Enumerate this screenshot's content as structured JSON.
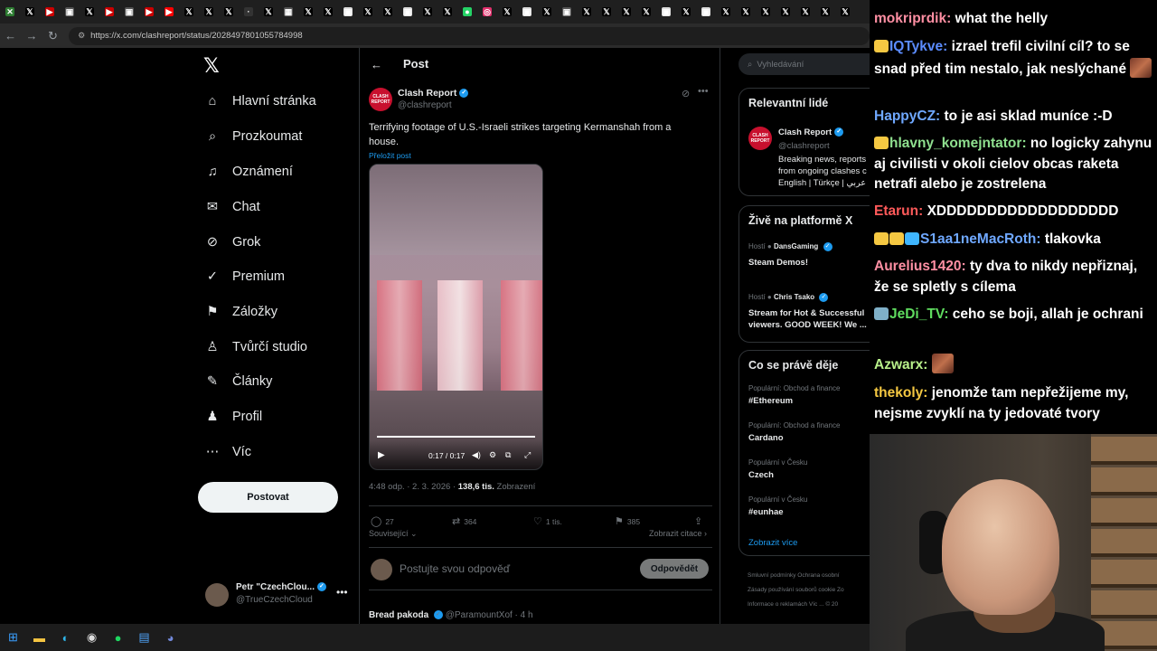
{
  "browser": {
    "url": "https://x.com/clashreport/status/2028497801055784998",
    "tabs": [
      {
        "icon": "green-x-icon",
        "color": "#2e7d32",
        "glyph": "✕"
      },
      {
        "icon": "x-icon",
        "color": "#000",
        "glyph": "𝕏"
      },
      {
        "icon": "youtube-icon",
        "color": "#c00",
        "glyph": "▶"
      },
      {
        "icon": "app-icon",
        "color": "#555",
        "glyph": "▣"
      },
      {
        "icon": "x-icon",
        "color": "#000",
        "glyph": "𝕏"
      },
      {
        "icon": "youtube-icon",
        "color": "#c00",
        "glyph": "▶"
      },
      {
        "icon": "app-icon",
        "color": "#555",
        "glyph": "▣"
      },
      {
        "icon": "youtube-icon",
        "color": "#c00",
        "glyph": "▶"
      },
      {
        "icon": "youtube-icon",
        "color": "#f00",
        "glyph": "▶"
      },
      {
        "icon": "x-icon",
        "color": "#000",
        "glyph": "𝕏"
      },
      {
        "icon": "x-icon",
        "color": "#000",
        "glyph": "𝕏"
      },
      {
        "icon": "x-icon",
        "color": "#000",
        "glyph": "𝕏"
      },
      {
        "icon": "blank-icon",
        "color": "#333",
        "glyph": "·"
      },
      {
        "icon": "x-icon",
        "color": "#000",
        "glyph": "𝕏"
      },
      {
        "icon": "app-icon",
        "color": "#555",
        "glyph": "▦"
      },
      {
        "icon": "x-icon",
        "color": "#000",
        "glyph": "𝕏"
      },
      {
        "icon": "x-icon",
        "color": "#000",
        "glyph": "𝕏"
      },
      {
        "icon": "app-icon",
        "color": "#ddd",
        "glyph": "▣"
      },
      {
        "icon": "x-icon",
        "color": "#000",
        "glyph": "𝕏"
      },
      {
        "icon": "x-icon",
        "color": "#000",
        "glyph": "𝕏"
      },
      {
        "icon": "app-icon",
        "color": "#ddd",
        "glyph": "▣"
      },
      {
        "icon": "x-icon",
        "color": "#000",
        "glyph": "𝕏"
      },
      {
        "icon": "x-icon",
        "color": "#000",
        "glyph": "𝕏"
      },
      {
        "icon": "whatsapp-icon",
        "color": "#25d366",
        "glyph": "●"
      },
      {
        "icon": "instagram-icon",
        "color": "#e1306c",
        "glyph": "◎"
      },
      {
        "icon": "x-icon",
        "color": "#000",
        "glyph": "𝕏"
      },
      {
        "icon": "app-icon",
        "color": "#ddd",
        "glyph": "▣"
      },
      {
        "icon": "x-icon",
        "color": "#000",
        "glyph": "𝕏"
      },
      {
        "icon": "app-icon",
        "color": "#555",
        "glyph": "▣"
      },
      {
        "icon": "x-icon",
        "color": "#000",
        "glyph": "𝕏"
      },
      {
        "icon": "x-icon",
        "color": "#000",
        "glyph": "𝕏"
      },
      {
        "icon": "x-icon",
        "color": "#000",
        "glyph": "𝕏"
      },
      {
        "icon": "x-icon",
        "color": "#000",
        "glyph": "𝕏"
      },
      {
        "icon": "app-icon",
        "color": "#ddd",
        "glyph": "▣"
      },
      {
        "icon": "x-icon",
        "color": "#000",
        "glyph": "𝕏"
      },
      {
        "icon": "app-icon",
        "color": "#ddd",
        "glyph": "▣"
      },
      {
        "icon": "x-icon",
        "color": "#000",
        "glyph": "𝕏"
      },
      {
        "icon": "x-icon",
        "color": "#000",
        "glyph": "𝕏"
      },
      {
        "icon": "x-icon",
        "color": "#000",
        "glyph": "𝕏"
      },
      {
        "icon": "x-icon",
        "color": "#000",
        "glyph": "𝕏"
      },
      {
        "icon": "x-icon",
        "color": "#000",
        "glyph": "𝕏"
      },
      {
        "icon": "x-icon",
        "color": "#000",
        "glyph": "𝕏"
      },
      {
        "icon": "x-icon",
        "color": "#000",
        "glyph": "𝕏"
      }
    ]
  },
  "nav": {
    "logo": "𝕏",
    "items": [
      {
        "label": "Hlavní stránka",
        "icon": "home-icon",
        "glyph": "⌂"
      },
      {
        "label": "Prozkoumat",
        "icon": "search-icon",
        "glyph": "⌕"
      },
      {
        "label": "Oznámení",
        "icon": "bell-icon",
        "glyph": "♫"
      },
      {
        "label": "Chat",
        "icon": "mail-icon",
        "glyph": "✉"
      },
      {
        "label": "Grok",
        "icon": "grok-icon",
        "glyph": "⊘"
      },
      {
        "label": "Premium",
        "icon": "verified-icon",
        "glyph": "✓"
      },
      {
        "label": "Záložky",
        "icon": "bookmark-icon",
        "glyph": "⚑"
      },
      {
        "label": "Tvůrčí studio",
        "icon": "studio-icon",
        "glyph": "♙"
      },
      {
        "label": "Články",
        "icon": "article-icon",
        "glyph": "✎"
      },
      {
        "label": "Profil",
        "icon": "profile-icon",
        "glyph": "♟"
      },
      {
        "label": "Víc",
        "icon": "more-icon",
        "glyph": "⋯"
      }
    ],
    "post_button": "Postovat",
    "profile_name": "Petr \"CzechClou...",
    "profile_handle": "@TrueCzechCloud"
  },
  "post": {
    "header_title": "Post",
    "author": "Clash Report",
    "handle": "@clashreport",
    "avatar_text": "CLASH REPORT",
    "text": "Terrifying footage of U.S.-Israeli strikes targeting Kermanshah from a house.",
    "translate": "Přeložit post",
    "video_time": "0:17 / 0:17",
    "video_progress": 1.0,
    "timestamp": "4:48 odp. · 2. 3. 2026 · ",
    "views_count": "138,6 tis.",
    "views_label": "Zobrazení",
    "replies": "27",
    "reposts": "364",
    "likes": "1 tis.",
    "bookmarks": "385",
    "related": "Související",
    "quotes": "Zobrazit citace",
    "reply_placeholder": "Postujte svou odpověď",
    "reply_button": "Odpovědět",
    "next_author": "Bread pakoda",
    "next_meta": "@ParamountXof · 4 h"
  },
  "sidebar": {
    "search_placeholder": "Vyhledávání",
    "relevant_title": "Relevantní lidé",
    "relevant_name": "Clash Report",
    "relevant_handle": "@clashreport",
    "relevant_bio_1": "Breaking news, reports",
    "relevant_bio_2": "from ongoing clashes c",
    "relevant_bio_3": "English | Türkçe | عربي",
    "live_title": "Živě na platformě X",
    "live_1_host": "Hostí",
    "live_1_name": "DansGaming",
    "live_1_title": "Steam Demos!",
    "live_2_host": "Hostí",
    "live_2_name": "Chris Tsako",
    "live_2_title_1": "Stream for Hot & Successful",
    "live_2_title_2": "viewers. GOOD WEEK! We ...",
    "trends_title": "Co se právě děje",
    "trends": [
      {
        "context": "Populární: Obchod a finance",
        "name": "#Ethereum"
      },
      {
        "context": "Populární: Obchod a finance",
        "name": "Cardano"
      },
      {
        "context": "Populární v Česku",
        "name": "Czech"
      },
      {
        "context": "Populární v Česku",
        "name": "#eunhae"
      }
    ],
    "show_more": "Zobrazit více",
    "footer_1": "Smluvní podmínky   Ochrana osobní",
    "footer_2": "Zásady používání souborů cookie   Zo",
    "footer_3": "Informace o reklamách   Víc ...   © 20"
  },
  "chat": [
    {
      "user": "mokriprdik",
      "color": "#ff8fa3",
      "text": "what the helly",
      "badges": []
    },
    {
      "user": "IQTykve",
      "color": "#5b8cff",
      "text": "izrael trefil civilní cíl? to se snad před tim nestalo, jak neslýchané",
      "badges": [
        "#f5c842"
      ],
      "emote_after": true
    },
    {
      "user": "HappyCZ",
      "color": "#6fa8ff",
      "text": "to je asi sklad muníce :-D",
      "badges": []
    },
    {
      "user": "hlavny_komejntator",
      "color": "#8fe08f",
      "text": "no logicky zahynu aj civilisti v okoli cielov obcas raketa netrafi alebo je zostrelena",
      "badges": [
        "#f5c842"
      ]
    },
    {
      "user": "Etarun",
      "color": "#ff5a5a",
      "text": "XDDDDDDDDDDDDDDDDDD",
      "badges": []
    },
    {
      "user": "S1aa1neMacRoth",
      "color": "#6fa8ff",
      "text": "tlakovka",
      "badges": [
        "#f5c842",
        "#f5c842",
        "#3fb6ff"
      ]
    },
    {
      "user": "Aurelius1420",
      "color": "#ff8fa3",
      "text": "ty dva to nikdy nepřiznaj, že se spletly s cílema",
      "badges": []
    },
    {
      "user": "JeDi_TV",
      "color": "#5fdc5f",
      "text": "ceho se boji, allah je ochrani",
      "badges": [
        "#7fb0c8"
      ]
    },
    {
      "user": "Azwarx",
      "color": "#b8f08a",
      "text": "",
      "badges": [],
      "emote_after": true
    },
    {
      "user": "thekoly",
      "color": "#f5c842",
      "text": "jenomže tam nepřežijeme my, nejsme zvyklí na ty jedovaté tvory",
      "badges": []
    }
  ],
  "taskbar": [
    {
      "icon": "windows-icon",
      "glyph": "⊞",
      "color": "#3aa0ff"
    },
    {
      "icon": "folder-icon",
      "glyph": "▬",
      "color": "#f5c542"
    },
    {
      "icon": "edge-icon",
      "glyph": "◐",
      "color": "#2fb5e8"
    },
    {
      "icon": "obs-icon",
      "glyph": "◉",
      "color": "#ddd"
    },
    {
      "icon": "spotify-icon",
      "glyph": "●",
      "color": "#1ed760"
    },
    {
      "icon": "notes-icon",
      "glyph": "▤",
      "color": "#4fa3f7"
    },
    {
      "icon": "discord-icon",
      "glyph": "◕",
      "color": "#7289da"
    }
  ]
}
